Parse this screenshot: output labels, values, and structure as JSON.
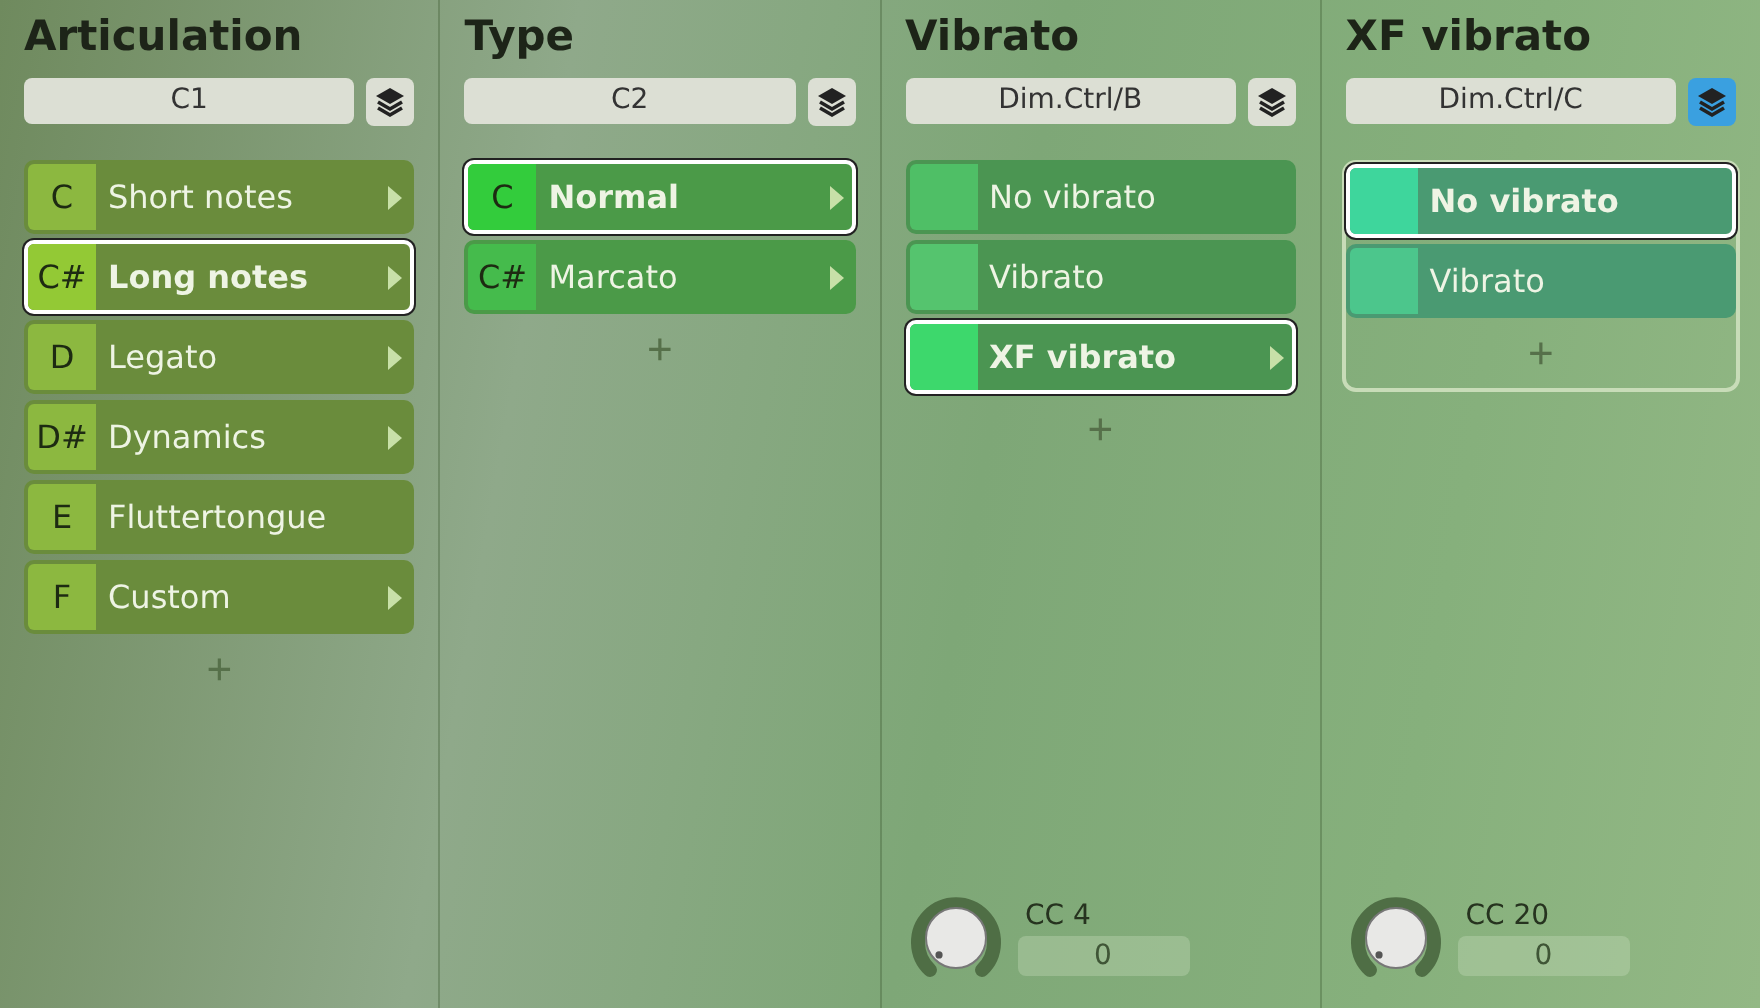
{
  "columns": [
    {
      "title": "Articulation",
      "field": "C1",
      "layers_active": false,
      "grouped": false,
      "items": [
        {
          "key": "C",
          "label": "Short notes",
          "selected": false,
          "has_children": true,
          "color": "#8cb840"
        },
        {
          "key": "C#",
          "label": "Long notes",
          "selected": true,
          "has_children": true,
          "color": "#93c935"
        },
        {
          "key": "D",
          "label": "Legato",
          "selected": false,
          "has_children": true,
          "color": "#8cb840"
        },
        {
          "key": "D#",
          "label": "Dynamics",
          "selected": false,
          "has_children": true,
          "color": "#8cb840"
        },
        {
          "key": "E",
          "label": "Fluttertongue",
          "selected": false,
          "has_children": false,
          "color": "#8cb840"
        },
        {
          "key": "F",
          "label": "Custom",
          "selected": false,
          "has_children": true,
          "color": "#8cb840"
        }
      ],
      "plus": "+"
    },
    {
      "title": "Type",
      "field": "C2",
      "layers_active": false,
      "grouped": false,
      "items": [
        {
          "key": "C",
          "label": "Normal",
          "selected": true,
          "has_children": true,
          "color": "#33cc3c"
        },
        {
          "key": "C#",
          "label": "Marcato",
          "selected": false,
          "has_children": true,
          "color": "#45bb4c"
        }
      ],
      "plus": "+"
    },
    {
      "title": "Vibrato",
      "field": "Dim.Ctrl/B",
      "layers_active": false,
      "grouped": false,
      "items": [
        {
          "label": "No vibrato",
          "selected": false,
          "has_children": false,
          "color": "#4fbf66"
        },
        {
          "label": "Vibrato",
          "selected": false,
          "has_children": false,
          "color": "#55c46e"
        },
        {
          "label": "XF vibrato",
          "selected": true,
          "has_children": true,
          "color": "#3dd86c"
        }
      ],
      "plus": "+",
      "knob": {
        "label": "CC 4",
        "value": "0"
      }
    },
    {
      "title": "XF vibrato",
      "field": "Dim.Ctrl/C",
      "layers_active": true,
      "grouped": true,
      "items": [
        {
          "label": "No vibrato",
          "selected": true,
          "has_children": false,
          "color": "#3ed69c"
        },
        {
          "label": "Vibrato",
          "selected": false,
          "has_children": false,
          "color": "#4cc68c"
        }
      ],
      "plus": "+",
      "knob": {
        "label": "CC 20",
        "value": "0"
      }
    }
  ]
}
